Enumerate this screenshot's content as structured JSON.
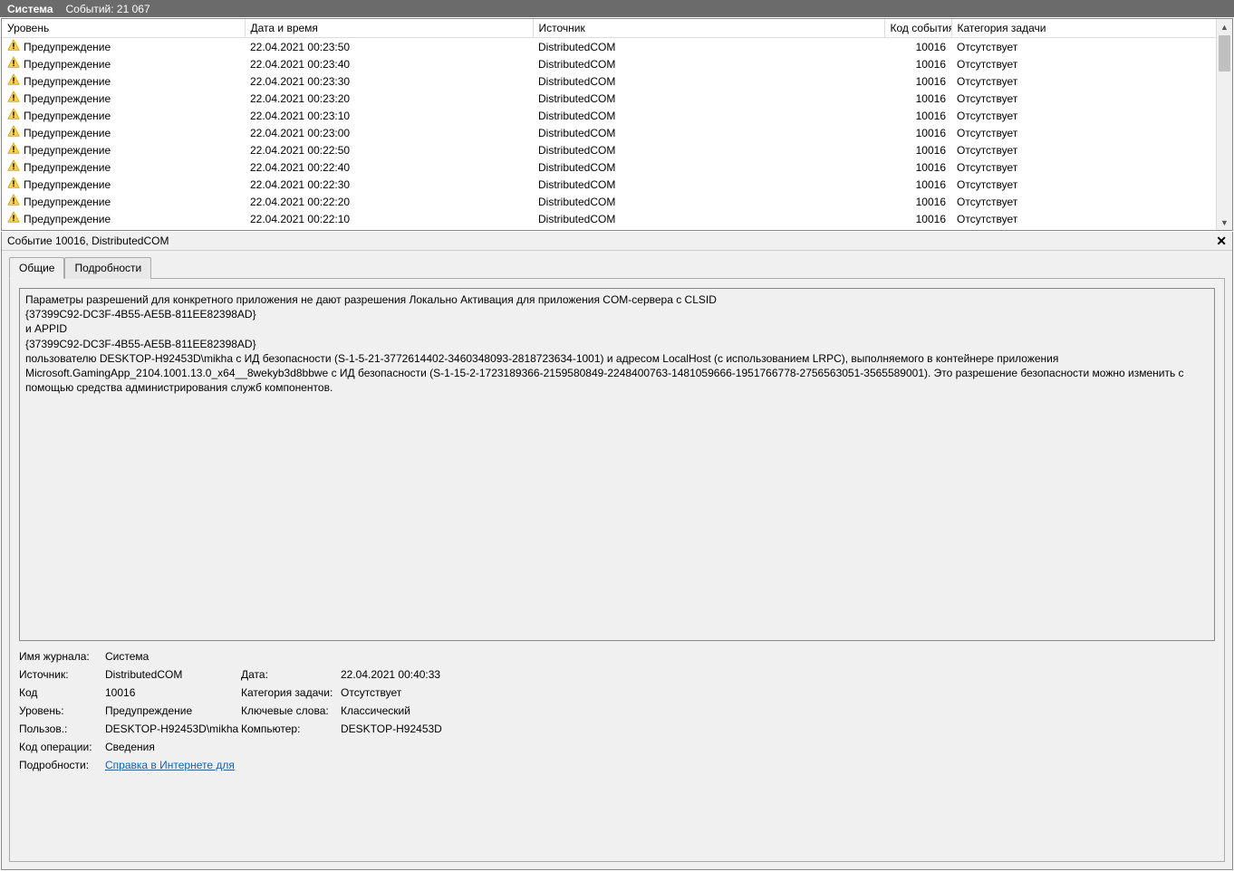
{
  "header": {
    "title": "Система",
    "events_label": "Событий: 21 067"
  },
  "columns": {
    "level": "Уровень",
    "datetime": "Дата и время",
    "source": "Источник",
    "event_id": "Код события",
    "task": "Категория задачи"
  },
  "rows": [
    {
      "level": "Предупреждение",
      "dt": "22.04.2021 00:23:50",
      "src": "DistributedCOM",
      "id": "10016",
      "task": "Отсутствует"
    },
    {
      "level": "Предупреждение",
      "dt": "22.04.2021 00:23:40",
      "src": "DistributedCOM",
      "id": "10016",
      "task": "Отсутствует"
    },
    {
      "level": "Предупреждение",
      "dt": "22.04.2021 00:23:30",
      "src": "DistributedCOM",
      "id": "10016",
      "task": "Отсутствует"
    },
    {
      "level": "Предупреждение",
      "dt": "22.04.2021 00:23:20",
      "src": "DistributedCOM",
      "id": "10016",
      "task": "Отсутствует"
    },
    {
      "level": "Предупреждение",
      "dt": "22.04.2021 00:23:10",
      "src": "DistributedCOM",
      "id": "10016",
      "task": "Отсутствует"
    },
    {
      "level": "Предупреждение",
      "dt": "22.04.2021 00:23:00",
      "src": "DistributedCOM",
      "id": "10016",
      "task": "Отсутствует"
    },
    {
      "level": "Предупреждение",
      "dt": "22.04.2021 00:22:50",
      "src": "DistributedCOM",
      "id": "10016",
      "task": "Отсутствует"
    },
    {
      "level": "Предупреждение",
      "dt": "22.04.2021 00:22:40",
      "src": "DistributedCOM",
      "id": "10016",
      "task": "Отсутствует"
    },
    {
      "level": "Предупреждение",
      "dt": "22.04.2021 00:22:30",
      "src": "DistributedCOM",
      "id": "10016",
      "task": "Отсутствует"
    },
    {
      "level": "Предупреждение",
      "dt": "22.04.2021 00:22:20",
      "src": "DistributedCOM",
      "id": "10016",
      "task": "Отсутствует"
    },
    {
      "level": "Предупреждение",
      "dt": "22.04.2021 00:22:10",
      "src": "DistributedCOM",
      "id": "10016",
      "task": "Отсутствует"
    }
  ],
  "detail": {
    "title": "Событие 10016, DistributedCOM",
    "tabs": {
      "general": "Общие",
      "details": "Подробности"
    },
    "description": "Параметры разрешений для конкретного приложения не дают разрешения Локально Активация для приложения COM-сервера с CLSID\n{37399C92-DC3F-4B55-AE5B-811EE82398AD}\n и APPID\n{37399C92-DC3F-4B55-AE5B-811EE82398AD}\n пользователю DESKTOP-H92453D\\mikha с ИД безопасности (S-1-5-21-3772614402-3460348093-2818723634-1001) и адресом LocalHost (с использованием LRPC), выполняемого в контейнере приложения Microsoft.GamingApp_2104.1001.13.0_x64__8wekyb3d8bbwe с ИД безопасности (S-1-15-2-1723189366-2159580849-2248400763-1481059666-1951766778-2756563051-3565589001). Это разрешение безопасности можно изменить с помощью средства администрирования служб компонентов.",
    "labels": {
      "log_name": "Имя журнала:",
      "source": "Источник:",
      "event_id_short": "Код",
      "level": "Уровень:",
      "user": "Пользов.:",
      "opcode": "Код операции:",
      "more_info": "Подробности:",
      "date": "Дата:",
      "task_cat": "Категория задачи:",
      "keywords": "Ключевые слова:",
      "computer": "Компьютер:"
    },
    "values": {
      "log_name": "Система",
      "source": "DistributedCOM",
      "event_id": "10016",
      "level": "Предупреждение",
      "user": "DESKTOP-H92453D\\mikha",
      "opcode": "Сведения",
      "link": "Справка в Интернете для ",
      "date": "22.04.2021 00:40:33",
      "task_cat": "Отсутствует",
      "keywords": "Классический",
      "computer": "DESKTOP-H92453D"
    }
  }
}
